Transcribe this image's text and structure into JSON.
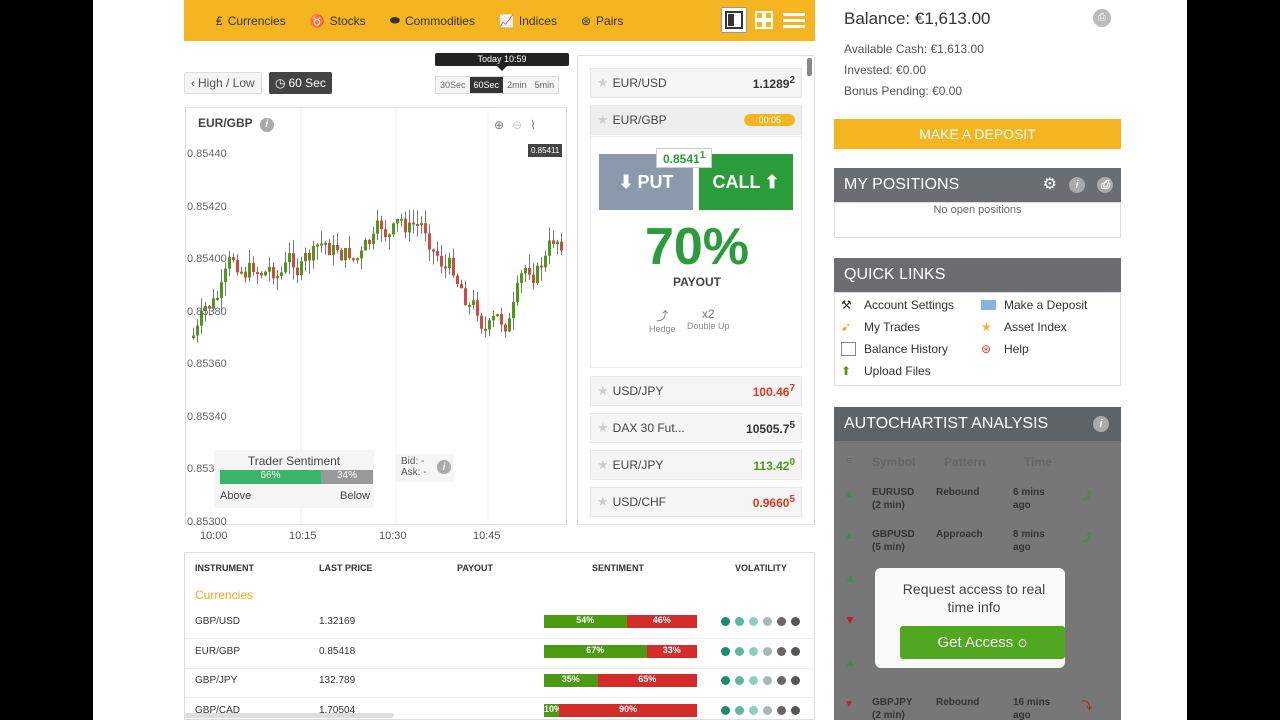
{
  "nav": {
    "items": [
      {
        "label": "Currencies",
        "icon": "currency-icon"
      },
      {
        "label": "Stocks",
        "icon": "bull-icon"
      },
      {
        "label": "Commodities",
        "icon": "commodity-icon"
      },
      {
        "label": "Indices",
        "icon": "indices-icon"
      },
      {
        "label": "Pairs",
        "icon": "pairs-icon"
      }
    ]
  },
  "chart": {
    "high_low_label": "High / Low",
    "period_label": "60 Sec",
    "time_label": "Today 10:59",
    "intervals": [
      "30Sec",
      "60Sec",
      "2min",
      "5min"
    ],
    "symbol": "EUR/GBP",
    "current_price": "0.85411",
    "y_labels": [
      "0.85440",
      "0.85420",
      "0.85400",
      "0.85380",
      "0.85360",
      "0.85340",
      "0.85320",
      "0.85300"
    ],
    "x_labels": [
      "10:00",
      "10:15",
      "10:30",
      "10:45"
    ],
    "sentiment": {
      "title": "Trader Sentiment",
      "above": "66%",
      "below": "34%",
      "above_label": "Above",
      "below_label": "Below"
    },
    "bid": "Bid: -",
    "ask": "Ask: -"
  },
  "assets": {
    "top": [
      {
        "name": "EUR/USD",
        "price": "1.1289",
        "sup": "2"
      },
      {
        "name": "EUR/GBP",
        "timer": "00:05"
      }
    ],
    "trade": {
      "strike": "0.8541",
      "strike_sup": "1",
      "put": "PUT",
      "call": "CALL",
      "payout": "70%",
      "payout_label": "PAYOUT",
      "hedge": "Hedge",
      "double_up_x": "x2",
      "double_up": "Double Up"
    },
    "list": [
      {
        "name": "USD/JPY",
        "price": "100.46",
        "sup": "7",
        "color": "red"
      },
      {
        "name": "DAX 30 Fut...",
        "price": "10505.7",
        "sup": "5",
        "color": "dark"
      },
      {
        "name": "EUR/JPY",
        "price": "113.42",
        "sup": "0",
        "color": "green"
      },
      {
        "name": "USD/CHF",
        "price": "0.9660",
        "sup": "5",
        "color": "red"
      }
    ]
  },
  "table": {
    "headers": [
      "INSTRUMENT",
      "LAST PRICE",
      "PAYOUT",
      "SENTIMENT",
      "VOLATILITY"
    ],
    "section": "Currencies",
    "rows": [
      {
        "instrument": "GBP/USD",
        "price": "1.32169",
        "green": "54%",
        "red": "46%",
        "g": 54
      },
      {
        "instrument": "EUR/GBP",
        "price": "0.85418",
        "green": "67%",
        "red": "33%",
        "g": 67
      },
      {
        "instrument": "GBP/JPY",
        "price": "132.789",
        "green": "35%",
        "red": "65%",
        "g": 35
      },
      {
        "instrument": "GBP/CAD",
        "price": "1.70504",
        "green": "10%",
        "red": "90%",
        "g": 10
      }
    ]
  },
  "account": {
    "balance": "Balance: €1,613.00",
    "available": "Available Cash: €1,613.00",
    "invested": "Invested: €0.00",
    "bonus": "Bonus Pending: €0.00",
    "deposit_btn": "MAKE A DEPOSIT"
  },
  "positions": {
    "title": "MY POSITIONS",
    "empty": "No open positions"
  },
  "quick_links": {
    "title": "QUICK LINKS",
    "items": [
      {
        "label": "Account Settings",
        "icon": "tools-icon"
      },
      {
        "label": "Make a Deposit",
        "icon": "card-icon"
      },
      {
        "label": "My Trades",
        "icon": "trades-icon"
      },
      {
        "label": "Asset Index",
        "icon": "star-icon"
      },
      {
        "label": "Balance History",
        "icon": "calendar-icon"
      },
      {
        "label": "Help",
        "icon": "lifebuoy-icon"
      },
      {
        "label": "Upload Files",
        "icon": "upload-icon"
      }
    ]
  },
  "autochartist": {
    "title": "AUTOCHARTIST ANALYSIS",
    "headers": [
      "Symbol",
      "Pattern",
      "Time"
    ],
    "rows": [
      {
        "symbol": "EURUSD",
        "period": "(2 min)",
        "pattern": "Rebound",
        "time": "6 mins",
        "ago": "ago",
        "dir": "up"
      },
      {
        "symbol": "GBPUSD",
        "period": "(5 min)",
        "pattern": "Approach",
        "time": "8 mins",
        "ago": "ago",
        "dir": "up"
      },
      {
        "symbol": "GBPJPY",
        "period": "(2 min)",
        "pattern": "Rebound",
        "time": "16 mins",
        "ago": "ago",
        "dir": "down"
      }
    ],
    "access_text": "Request access to real time info",
    "access_btn": "Get Access"
  }
}
